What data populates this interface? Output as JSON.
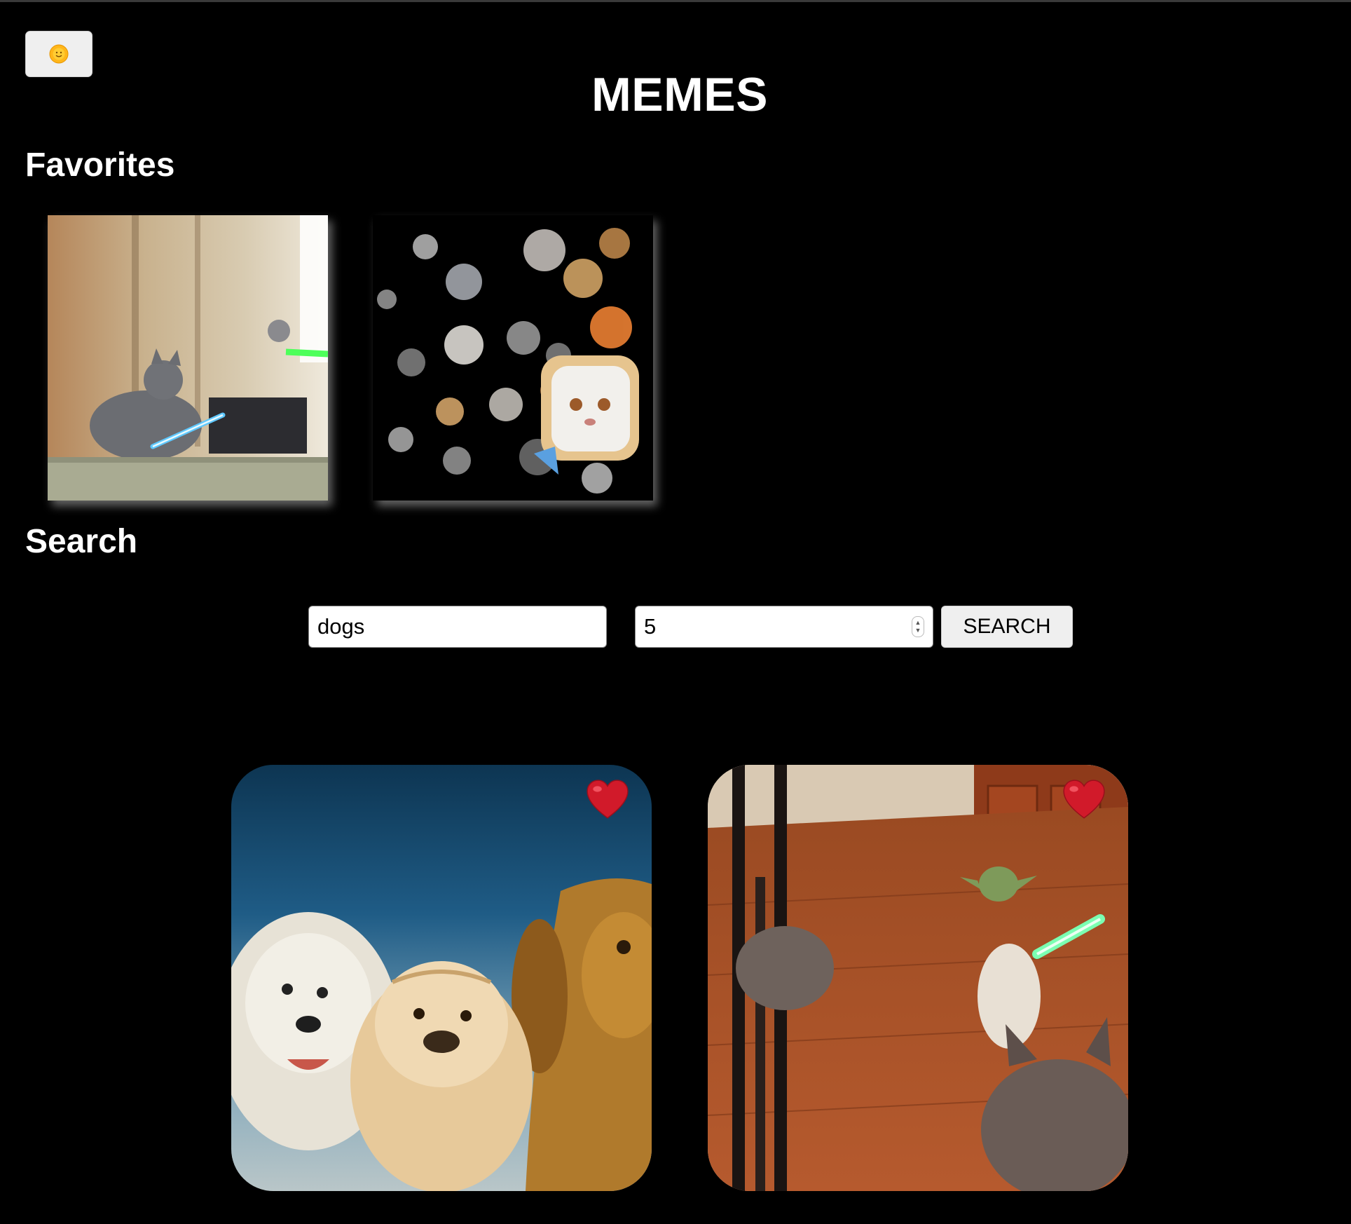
{
  "app": {
    "title": "MEMES",
    "theme_toggle_icon": "sun-emoji-icon"
  },
  "favorites": {
    "heading": "Favorites",
    "items": [
      {
        "name": "kitten-lightsaber-gif"
      },
      {
        "name": "flying-cat-heads-gif"
      }
    ]
  },
  "search": {
    "heading": "Search",
    "query": "dogs",
    "limit": "5",
    "button_label": "SEARCH"
  },
  "results": {
    "items": [
      {
        "name": "dogs-group-gif",
        "favorite_icon": "heart-icon"
      },
      {
        "name": "yoda-dog-lightsaber-gif",
        "favorite_icon": "heart-icon"
      }
    ]
  },
  "colors": {
    "background": "#000000",
    "text": "#ffffff",
    "heart": "#d11a2a"
  }
}
